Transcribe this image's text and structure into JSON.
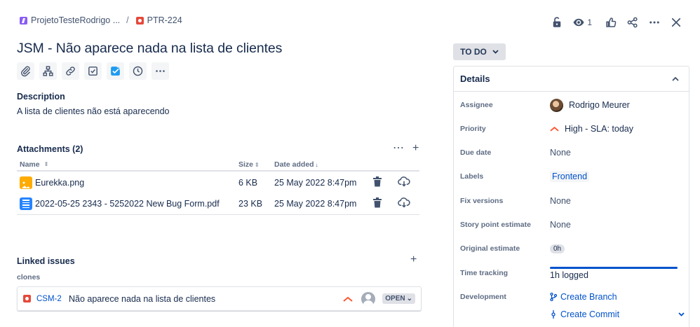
{
  "breadcrumb": {
    "project": "ProjetoTesteRodrigo ...",
    "separator": "/",
    "issue_key": "PTR-224"
  },
  "top_actions": {
    "watch_count": "1",
    "icons": [
      "unlock-icon",
      "eye-icon",
      "thumbs-up-icon",
      "share-icon",
      "more-icon",
      "close-icon"
    ]
  },
  "issue": {
    "title": "JSM - Não aparece nada na lista de clientes"
  },
  "toolbar_icons": [
    "attach-icon",
    "child-issue-icon",
    "link-icon",
    "checklist-icon",
    "checklist-app-icon",
    "time-icon",
    "more-icon"
  ],
  "description": {
    "heading": "Description",
    "text": "A lista de clientes não está aparecendo"
  },
  "attachments": {
    "heading": "Attachments (2)",
    "columns": {
      "name": "Name",
      "size": "Size",
      "date": "Date added"
    },
    "rows": [
      {
        "name": "Eurekka.png",
        "size": "6 KB",
        "date": "25 May 2022 8:47pm",
        "type": "image"
      },
      {
        "name": "2022-05-25 2343 - 5252022 New Bug Form.pdf",
        "size": "23 KB",
        "date": "25 May 2022 8:47pm",
        "type": "document"
      }
    ]
  },
  "linked_issues": {
    "heading": "Linked issues",
    "relation": "clones",
    "items": [
      {
        "key": "CSM-2",
        "summary": "Não aparece nada na lista de clientes",
        "status": "OPEN"
      }
    ]
  },
  "status": {
    "label": "TO DO"
  },
  "details": {
    "heading": "Details",
    "assignee": {
      "label": "Assignee",
      "value": "Rodrigo Meurer"
    },
    "priority": {
      "label": "Priority",
      "value": "High - SLA: today"
    },
    "due_date": {
      "label": "Due date",
      "value": "None"
    },
    "labels": {
      "label": "Labels",
      "value": "Frontend"
    },
    "fix_versions": {
      "label": "Fix versions",
      "value": "None"
    },
    "story_points": {
      "label": "Story point estimate",
      "value": "None"
    },
    "original_estimate": {
      "label": "Original estimate",
      "value": "0h"
    },
    "time_tracking": {
      "label": "Time tracking",
      "value": "1h logged",
      "progress": 1.0
    },
    "development": {
      "label": "Development",
      "create_branch": "Create Branch",
      "create_commit": "Create Commit"
    }
  },
  "colors": {
    "link": "#0052cc",
    "priority_high": "#ff5630",
    "text": "#172b4d"
  }
}
